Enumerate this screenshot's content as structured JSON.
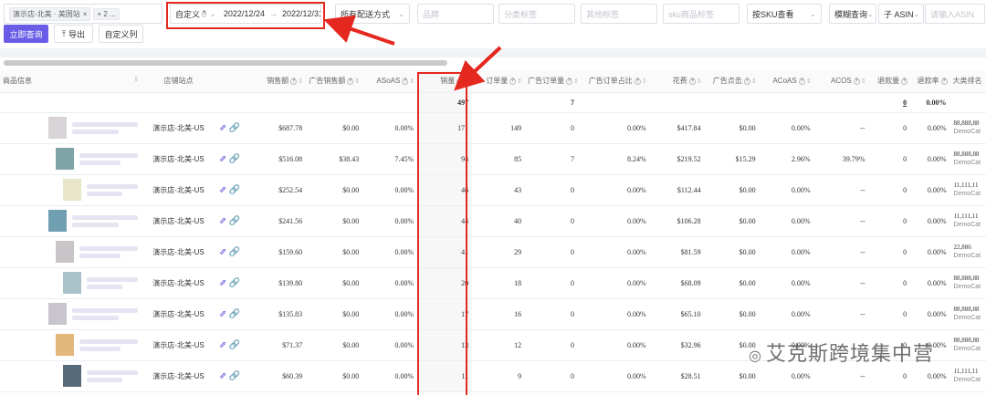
{
  "filters": {
    "store_tag": "演示店-北美 · 美国站",
    "store_more": "+ 2 ...",
    "date_mode": "自定义",
    "date_start": "2022/12/24",
    "date_sep": "→",
    "date_end": "2022/12/31",
    "delivery": "所有配送方式",
    "f_brand": "品牌",
    "f_cat": "分类标签",
    "f_tag": "其他标签",
    "f_sku": "sku商品标签",
    "sku_sum": "按SKU查看",
    "fuzzy": "模糊查询",
    "asin_type": "子 ASIN",
    "asin_input": "请输入ASIN"
  },
  "buttons": {
    "query": "立即查询",
    "export": "导出",
    "custom_cols": "自定义列"
  },
  "headers": {
    "product": "商品信息",
    "store": "店铺站点",
    "sales": "销售额",
    "ad_sales": "广告销售额",
    "asoas": "ASoAS",
    "qty": "销量",
    "orders": "订单量",
    "ad_orders": "广告订单量",
    "ad_order_ratio": "广告订单占比",
    "ad_spend": "花费",
    "ad_click": "广告点击",
    "acoas": "ACoAS",
    "acos": "ACOS",
    "returns": "退款量",
    "return_rate": "退款率",
    "category_rank": "大类排名"
  },
  "summary": {
    "qty": "497",
    "ad_orders": "7",
    "returns": "0",
    "return_rate": "0.00%"
  },
  "rows": [
    {
      "store": "演示店-北美-US",
      "sales": "$687.78",
      "ad_sales": "$0.00",
      "asoas": "0.00%",
      "qty": "171",
      "orders": "149",
      "ad_orders": "0",
      "ad_ratio": "0.00%",
      "spend": "$417.84",
      "click": "$0.00",
      "acoas": "0.00%",
      "acos": "--",
      "returns": "0",
      "rrate": "0.00%",
      "rank": "88,888,88",
      "cat": "DemoCat"
    },
    {
      "store": "演示店-北美-US",
      "sales": "$516.08",
      "ad_sales": "$38.43",
      "asoas": "7.45%",
      "qty": "94",
      "orders": "85",
      "ad_orders": "7",
      "ad_ratio": "8.24%",
      "spend": "$219.52",
      "click": "$15.29",
      "acoas": "2.96%",
      "acos": "39.79%",
      "returns": "0",
      "rrate": "0.00%",
      "rank": "88,888,88",
      "cat": "DemoCat"
    },
    {
      "store": "演示店-北美-US",
      "sales": "$252.54",
      "ad_sales": "$0.00",
      "asoas": "0.00%",
      "qty": "46",
      "orders": "43",
      "ad_orders": "0",
      "ad_ratio": "0.00%",
      "spend": "$112.44",
      "click": "$0.00",
      "acoas": "0.00%",
      "acos": "--",
      "returns": "0",
      "rrate": "0.00%",
      "rank": "11,111,11",
      "cat": "DemoCat"
    },
    {
      "store": "演示店-北美-US",
      "sales": "$241.56",
      "ad_sales": "$0.00",
      "asoas": "0.00%",
      "qty": "44",
      "orders": "40",
      "ad_orders": "0",
      "ad_ratio": "0.00%",
      "spend": "$106.28",
      "click": "$0.00",
      "acoas": "0.00%",
      "acos": "--",
      "returns": "0",
      "rrate": "0.00%",
      "rank": "11,111,11",
      "cat": "DemoCat"
    },
    {
      "store": "演示店-北美-US",
      "sales": "$159.60",
      "ad_sales": "$0.00",
      "asoas": "0.00%",
      "qty": "41",
      "orders": "29",
      "ad_orders": "0",
      "ad_ratio": "0.00%",
      "spend": "$81.59",
      "click": "$0.00",
      "acoas": "0.00%",
      "acos": "--",
      "returns": "0",
      "rrate": "0.00%",
      "rank": "22,886",
      "cat": "DemoCat"
    },
    {
      "store": "演示店-北美-US",
      "sales": "$139.80",
      "ad_sales": "$0.00",
      "asoas": "0.00%",
      "qty": "20",
      "orders": "18",
      "ad_orders": "0",
      "ad_ratio": "0.00%",
      "spend": "$68.09",
      "click": "$0.00",
      "acoas": "0.00%",
      "acos": "--",
      "returns": "0",
      "rrate": "0.00%",
      "rank": "88,888,88",
      "cat": "DemoCat"
    },
    {
      "store": "演示店-北美-US",
      "sales": "$135.83",
      "ad_sales": "$0.00",
      "asoas": "0.00%",
      "qty": "17",
      "orders": "16",
      "ad_orders": "0",
      "ad_ratio": "0.00%",
      "spend": "$65.10",
      "click": "$0.00",
      "acoas": "0.00%",
      "acos": "--",
      "returns": "0",
      "rrate": "0.00%",
      "rank": "88,888,88",
      "cat": "DemoCat"
    },
    {
      "store": "演示店-北美-US",
      "sales": "$71.37",
      "ad_sales": "$0.00",
      "asoas": "0.00%",
      "qty": "13",
      "orders": "12",
      "ad_orders": "0",
      "ad_ratio": "0.00%",
      "spend": "$32.96",
      "click": "$0.00",
      "acoas": "0.00%",
      "acos": "--",
      "returns": "0",
      "rrate": "0.00%",
      "rank": "88,888,88",
      "cat": "DemoCat"
    },
    {
      "store": "演示店-北美-US",
      "sales": "$60.39",
      "ad_sales": "$0.00",
      "asoas": "0.00%",
      "qty": "11",
      "orders": "9",
      "ad_orders": "0",
      "ad_ratio": "0.00%",
      "spend": "$28.51",
      "click": "$0.00",
      "acoas": "0.00%",
      "acos": "--",
      "returns": "0",
      "rrate": "0.00%",
      "rank": "11,111,11",
      "cat": "DemoCat"
    }
  ],
  "thumb_colors": [
    "#d8d3d6",
    "#7fa4a8",
    "#e8e6c9",
    "#6f9fb0",
    "#c9c4c8",
    "#a8c2c9",
    "#c8c6cc",
    "#e3b779",
    "#556a78"
  ],
  "watermark": "艾克斯跨境集中营",
  "colors": {
    "primary": "#6b5ce7",
    "highlight": "#e5281f"
  }
}
